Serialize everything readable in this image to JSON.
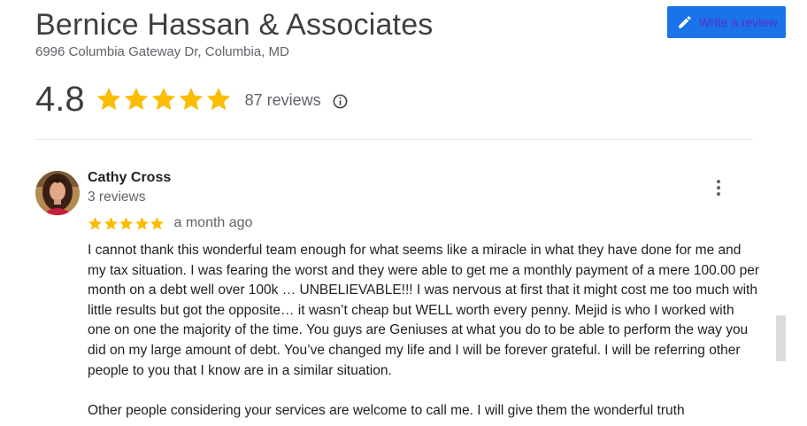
{
  "business": {
    "name": "Bernice Hassan & Associates",
    "address": "6996 Columbia Gateway Dr, Columbia, MD"
  },
  "actions": {
    "write_review_label": "Write a review",
    "write_review_icon": "pencil-icon"
  },
  "summary": {
    "rating": "4.8",
    "stars": 5,
    "review_count_label": "87 reviews",
    "info_icon": "info-icon"
  },
  "review": {
    "author": "Cathy Cross",
    "author_review_count": "3 reviews",
    "stars": 5,
    "date": "a month ago",
    "menu_icon": "more-vert-icon",
    "paragraphs": [
      "I cannot thank this wonderful team enough for what seems like a miracle in what they have done for me and my tax situation. I was fearing the worst and they were able to get me a monthly payment of a mere 100.00 per month on a debt well over 100k … UNBELIEVABLE!!! I was nervous at first that it might cost me too much with little results but got the opposite… it wasn’t cheap but WELL worth every penny. Mejid is who I worked with one on one the majority of the time. You guys are Geniuses at what you do to be able to perform the way you did on my large amount of debt. You’ve changed my life and I will be forever grateful. I will be referring other people to you that I know are in a similar situation.",
      "Other people considering your services are welcome to call me. I will give them the wonderful truth"
    ]
  },
  "colors": {
    "star": "#fbbc04",
    "button_bg": "#1a73e8",
    "button_text": "#5a2fc7",
    "divider": "#e8eaed",
    "scrollbar": "#dadce0"
  }
}
